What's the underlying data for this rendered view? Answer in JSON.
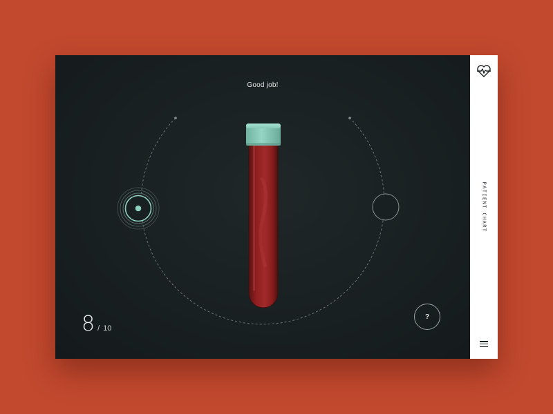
{
  "status": {
    "message": "Good job!"
  },
  "progress": {
    "current": "8",
    "separator": "/",
    "total": "10"
  },
  "controls": {
    "help_label": "?"
  },
  "sidebar": {
    "label": "PATIENT CHART",
    "logo_icon": "heart-pulse-icon",
    "menu_icon": "hamburger-menu-icon"
  },
  "colors": {
    "background": "#c2492e",
    "panel": "#192021",
    "accent": "#8fd1bd",
    "blood": "#8f1c1c",
    "cap": "#86c9b6"
  }
}
